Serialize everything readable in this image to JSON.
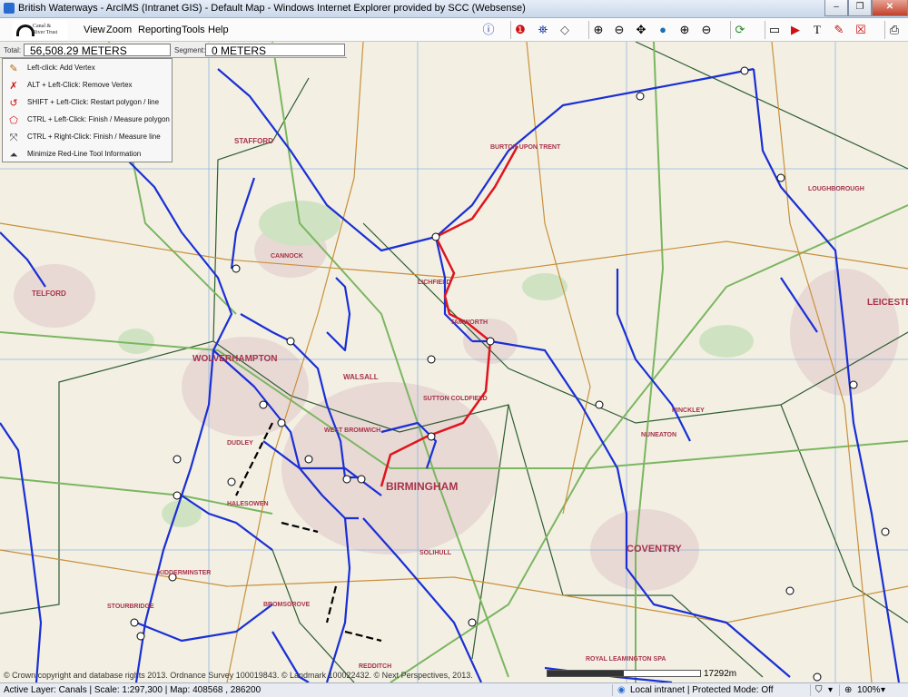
{
  "window": {
    "title": "British Waterways - ArcIMS (Intranet GIS) - Default Map - Windows Internet Explorer provided by SCC (Websense)",
    "buttons": {
      "minimize": "–",
      "maximize": "❐",
      "close": "✕"
    }
  },
  "logo": {
    "line1": "Canal &",
    "line2": "River Trust"
  },
  "menu": [
    "View",
    "Zoom",
    "Reporting",
    "Tools",
    "Help"
  ],
  "measure": {
    "total_label": "Total:",
    "total_value": "56,508.29 METERS",
    "segment_label": "Segment:",
    "segment_value": "0 METERS"
  },
  "help_panel": {
    "items": [
      {
        "icon": "pencil-icon",
        "text": "Left-click: Add Vertex"
      },
      {
        "icon": "remove-vertex-icon",
        "text": "ALT + Left-Click: Remove Vertex"
      },
      {
        "icon": "restart-icon",
        "text": "SHIFT + Left-Click: Restart polygon / line"
      },
      {
        "icon": "measure-polygon-icon",
        "text": "CTRL + Left-Click: Finish / Measure polygon"
      },
      {
        "icon": "measure-line-icon",
        "text": "CTRL + Right-Click: Finish / Measure line"
      },
      {
        "icon": "minimize-icon",
        "text": "Minimize Red-Line Tool Information"
      }
    ]
  },
  "map": {
    "places": [
      {
        "name": "STAFFORD"
      },
      {
        "name": "BURTON UPON TRENT"
      },
      {
        "name": "LOUGHBOROUGH"
      },
      {
        "name": "TELFORD"
      },
      {
        "name": "CANNOCK"
      },
      {
        "name": "LICHFIELD"
      },
      {
        "name": "LEICESTER"
      },
      {
        "name": "WOLVERHAMPTON"
      },
      {
        "name": "WALSALL"
      },
      {
        "name": "TAMWORTH"
      },
      {
        "name": "DUDLEY"
      },
      {
        "name": "WEST BROMWICH"
      },
      {
        "name": "BIRMINGHAM"
      },
      {
        "name": "HINCKLEY"
      },
      {
        "name": "NUNEATON"
      },
      {
        "name": "COVENTRY"
      },
      {
        "name": "SOLIHULL"
      },
      {
        "name": "KIDDERMINSTER"
      },
      {
        "name": "BROMSGROVE"
      },
      {
        "name": "HALESOWEN"
      },
      {
        "name": "STOURBRIDGE"
      },
      {
        "name": "ROYAL LEAMINGTON SPA"
      },
      {
        "name": "REDDITCH"
      },
      {
        "name": "SUTTON COLDFIELD"
      }
    ],
    "copyright": "© Crown copyright and database rights 2013. Ordnance Survey 100019843. © Landmark 100022432. © Next Perspectives, 2013.",
    "scale_label": "17292m"
  },
  "status": {
    "layer": "Active Layer: Canals | Scale: 1:297,300 | Map: 408568 , 286200",
    "zone": "Local intranet | Protected Mode: Off",
    "zoom": "100%"
  },
  "colors": {
    "canal": "#1a2fd6",
    "redline": "#e0141e",
    "road": "#6aa84f",
    "boundary": "#2e7d32"
  }
}
